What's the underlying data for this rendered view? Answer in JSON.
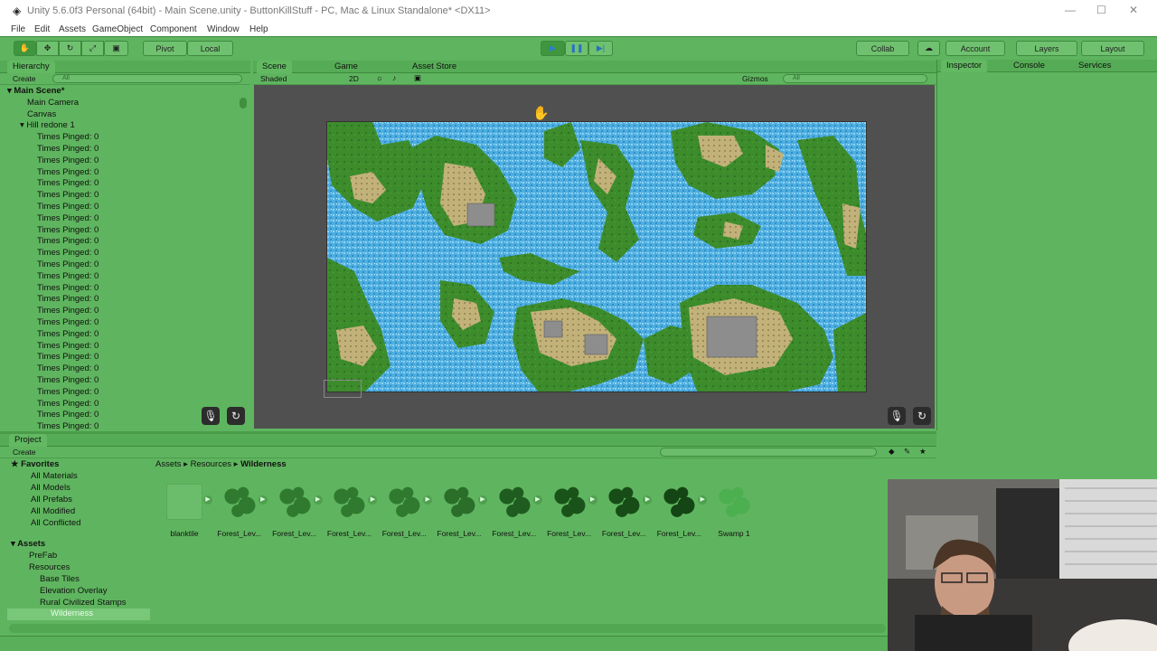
{
  "window": {
    "title": "Unity 5.6.0f3 Personal (64bit) - Main Scene.unity - ButtonKillStuff - PC, Mac & Linux Standalone* <DX11>"
  },
  "menu": [
    "File",
    "Edit",
    "Assets",
    "GameObject",
    "Component",
    "Window",
    "Help"
  ],
  "toolbar": {
    "pivot": "Pivot",
    "local": "Local",
    "collab": "Collab",
    "account": "Account",
    "layers": "Layers",
    "layout": "Layout"
  },
  "hierarchy": {
    "tab": "Hierarchy",
    "create": "Create",
    "search_placeholder": "All",
    "scene": "Main Scene*",
    "items": [
      "Main Camera",
      "Canvas",
      "Hill redone 1"
    ],
    "child_label": "Times Pinged: 0"
  },
  "scene": {
    "tabs": [
      "Scene",
      "Game",
      "Asset Store"
    ],
    "shaded": "Shaded",
    "mode2d": "2D",
    "gizmos": "Gizmos",
    "search_placeholder": "All"
  },
  "inspector": {
    "tabs": [
      "Inspector",
      "Console",
      "Services"
    ]
  },
  "project": {
    "tab": "Project",
    "create": "Create",
    "favorites_label": "Favorites",
    "favorites": [
      "All Materials",
      "All Models",
      "All Prefabs",
      "All Modified",
      "All Conflicted"
    ],
    "assets_label": "Assets",
    "folders": [
      "PreFab",
      "Resources",
      "Base Tiles",
      "Elevation Overlay",
      "Rural Civilized Stamps",
      "Wilderness"
    ],
    "breadcrumb": [
      "Assets",
      "Resources",
      "Wilderness"
    ],
    "asset_items": [
      "blanktile",
      "Forest_Lev...",
      "Forest_Lev...",
      "Forest_Lev...",
      "Forest_Lev...",
      "Forest_Lev...",
      "Forest_Lev...",
      "Forest_Lev...",
      "Forest_Lev...",
      "Forest_Lev...",
      "Swamp 1"
    ]
  },
  "colors": {
    "theme_green": "#5fb55f",
    "water": "#4eaee0",
    "land": "#3d8c2c",
    "sand": "#c2b27a"
  }
}
